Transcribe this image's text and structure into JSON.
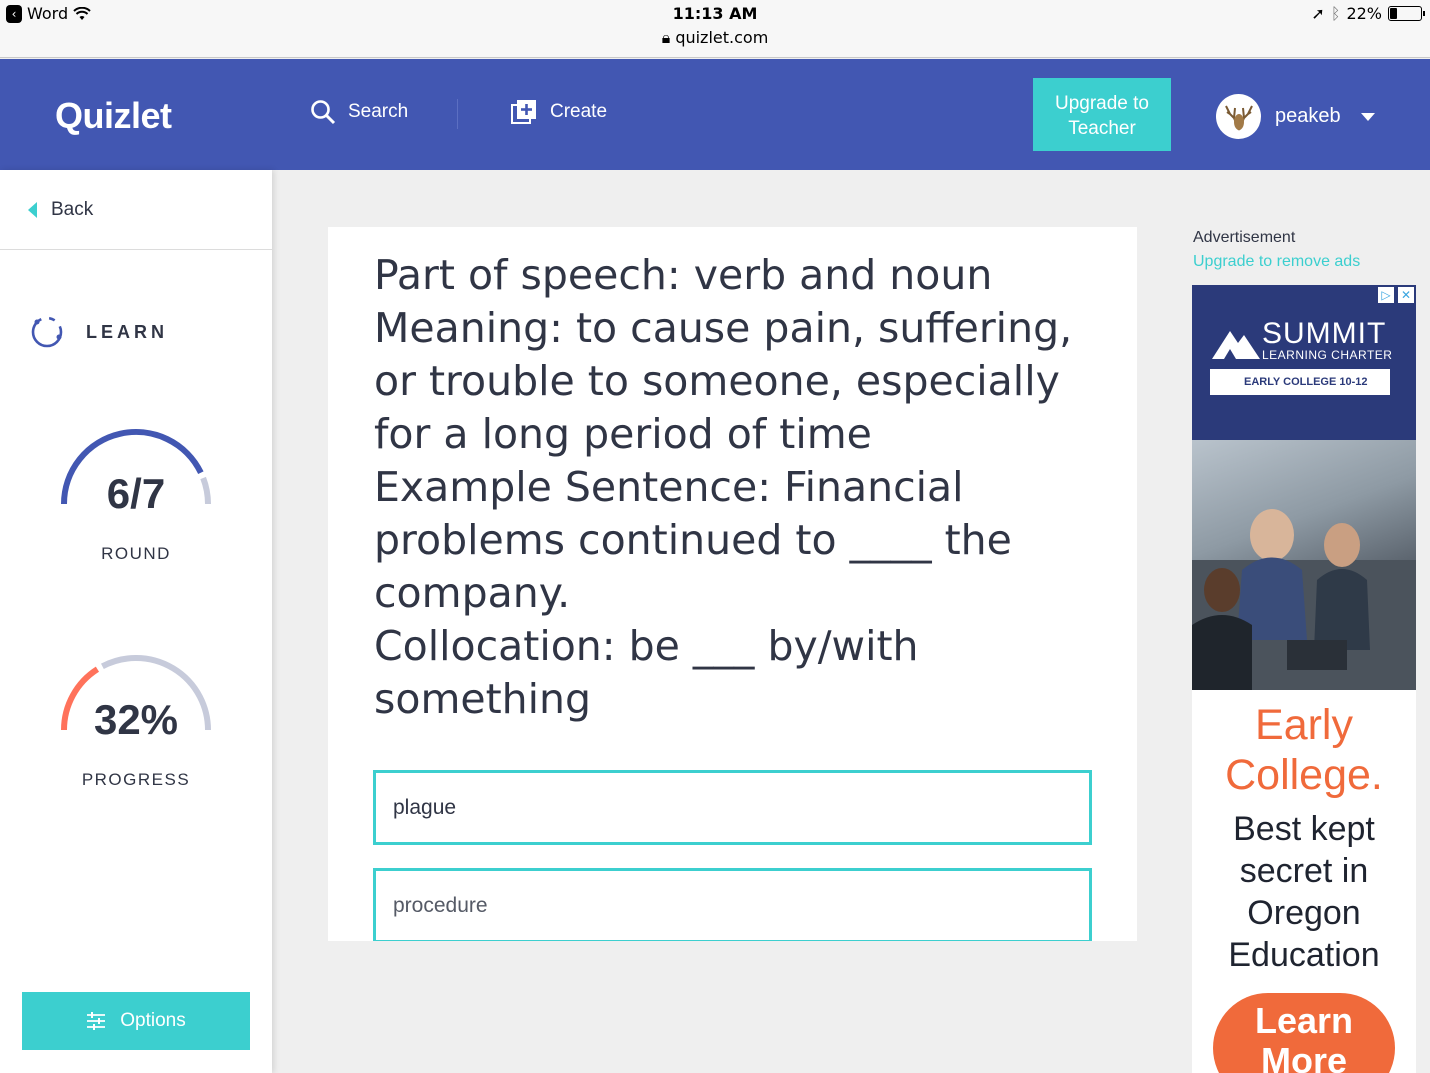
{
  "statusbar": {
    "back_app": "Word",
    "time": "11:13 AM",
    "url": "quizlet.com",
    "battery": "22%"
  },
  "header": {
    "logo": "Quizlet",
    "search_label": "Search",
    "create_label": "Create",
    "upgrade_label_line1": "Upgrade to",
    "upgrade_label_line2": "Teacher",
    "username": "peakeb"
  },
  "sidebar": {
    "back_label": "Back",
    "mode_label": "LEARN",
    "round": {
      "value": "6/7",
      "label": "ROUND",
      "fraction": 0.857
    },
    "progress": {
      "value": "32%",
      "label": "PROGRESS",
      "fraction": 0.32
    },
    "options_label": "Options"
  },
  "card": {
    "prompt_lines": [
      "Part of speech: verb and noun",
      "Meaning: to cause pain, suffering, or trouble to someone, especially for a long period of time",
      "Example Sentence: Financial problems continued to ____ the company.",
      "Collocation: be ___ by/with something"
    ],
    "answers": [
      "plague",
      "procedure"
    ]
  },
  "ad": {
    "heading": "Advertisement",
    "upgrade_link": "Upgrade to remove ads",
    "brand_title": "SUMMIT",
    "brand_sub": "LEARNING CHARTER",
    "brand_bar": "EARLY COLLEGE 10-12",
    "headline_line1": "Early",
    "headline_line2": "College.",
    "body_line1": "Best kept",
    "body_line2": "secret in",
    "body_line3": "Oregon",
    "body_line4": "Education",
    "cta_line1": "Learn",
    "cta_line2": "More"
  },
  "colors": {
    "header_blue": "#4257b2",
    "accent_teal": "#3ccfcf",
    "round_arc": "#4257b2",
    "progress_arc": "#ff725b",
    "ad_orange": "#f06a3b"
  }
}
